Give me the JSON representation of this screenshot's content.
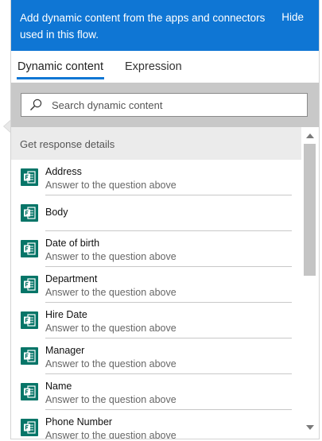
{
  "banner": {
    "text": "Add dynamic content from the apps and connectors used in this flow.",
    "hide_label": "Hide",
    "color": "#0f76d4"
  },
  "tabs": [
    {
      "label": "Dynamic content",
      "active": true
    },
    {
      "label": "Expression",
      "active": false
    }
  ],
  "search": {
    "placeholder": "Search dynamic content",
    "value": "",
    "icon": "search-icon"
  },
  "group": {
    "title": "Get response details",
    "icon": "forms-icon",
    "icon_color": "#077568"
  },
  "items": [
    {
      "label": "Address",
      "description": "Answer to the question above"
    },
    {
      "label": "Body",
      "description": ""
    },
    {
      "label": "Date of birth",
      "description": "Answer to the question above"
    },
    {
      "label": "Department",
      "description": "Answer to the question above"
    },
    {
      "label": "Hire Date",
      "description": "Answer to the question above"
    },
    {
      "label": "Manager",
      "description": "Answer to the question above"
    },
    {
      "label": "Name",
      "description": "Answer to the question above"
    },
    {
      "label": "Phone Number",
      "description": "Answer to the question above"
    }
  ]
}
